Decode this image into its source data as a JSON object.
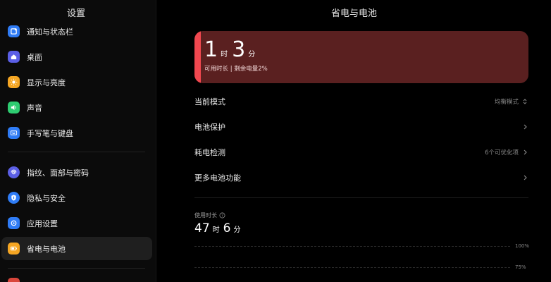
{
  "sidebar": {
    "title": "设置",
    "items": [
      {
        "label": "通知与状态栏",
        "icon": "notification-icon",
        "color": "#2f7cf6"
      },
      {
        "label": "桌面",
        "icon": "home-icon",
        "color": "#5b5fe6"
      },
      {
        "label": "显示与亮度",
        "icon": "sun-icon",
        "color": "#f5a623"
      },
      {
        "label": "声音",
        "icon": "speaker-icon",
        "color": "#2ecc71"
      },
      {
        "label": "手写笔与键盘",
        "icon": "keyboard-icon",
        "color": "#2f7cf6"
      },
      {
        "label": "指纹、面部与密码",
        "icon": "fingerprint-icon",
        "color": "#5b5fe6"
      },
      {
        "label": "隐私与安全",
        "icon": "privacy-icon",
        "color": "#2f7cf6"
      },
      {
        "label": "应用设置",
        "icon": "app-settings-icon",
        "color": "#2f7cf6"
      },
      {
        "label": "省电与电池",
        "icon": "battery-icon",
        "color": "#f5a623",
        "active": true
      }
    ]
  },
  "main": {
    "title": "省电与电池",
    "battery": {
      "hours": "1",
      "hours_unit": "时",
      "minutes": "3",
      "minutes_unit": "分",
      "subtitle": "可用时长 | 剩余电量2%",
      "level_percent": 2,
      "fill_color": "#f0474f",
      "card_color": "#5a2020"
    },
    "rows": [
      {
        "label": "当前模式",
        "value": "均衡模式",
        "chevron": "updown"
      },
      {
        "label": "电池保护",
        "value": "",
        "chevron": "right"
      },
      {
        "label": "耗电检测",
        "value": "6个可优化项",
        "chevron": "right"
      },
      {
        "label": "更多电池功能",
        "value": "",
        "chevron": "right"
      }
    ],
    "usage": {
      "label": "使用时长",
      "hours": "47",
      "hours_unit": "时",
      "minutes": "6",
      "minutes_unit": "分",
      "ticks": [
        "100%",
        "75%"
      ]
    }
  }
}
